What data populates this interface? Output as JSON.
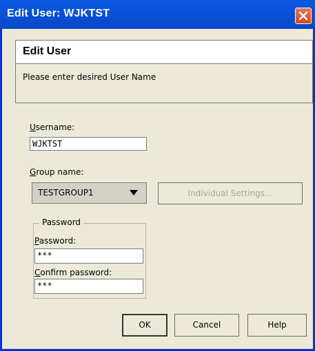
{
  "window": {
    "title": "Edit User: WJKTST"
  },
  "header": {
    "title": "Edit User",
    "description": "Please enter desired User Name"
  },
  "username": {
    "label_underlined": "U",
    "label_rest": "sername:",
    "value": "WJKTST"
  },
  "group": {
    "label_underlined": "G",
    "label_rest": "roup name:",
    "selected": "TESTGROUP1",
    "settings_button": "Individual Settings..."
  },
  "password": {
    "groupbox_title": "Password",
    "password_label_underlined": "P",
    "password_label_rest": "assword:",
    "password_value": "***",
    "confirm_label_underlined": "C",
    "confirm_label_rest": "onfirm password:",
    "confirm_value": "***"
  },
  "buttons": {
    "ok": "OK",
    "cancel": "Cancel",
    "help": "Help"
  },
  "colors": {
    "titlebar": "#0a58e0",
    "close_button": "#d3491f",
    "dialog_background": "#ece9d8"
  }
}
